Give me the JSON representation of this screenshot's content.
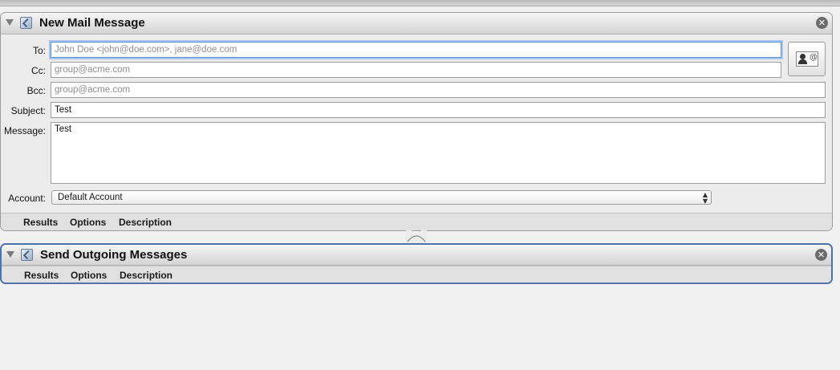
{
  "actions": [
    {
      "title": "New Mail Message",
      "labels": {
        "to": "To:",
        "cc": "Cc:",
        "bcc": "Bcc:",
        "subject": "Subject:",
        "message": "Message:",
        "account": "Account:"
      },
      "fields": {
        "to_placeholder": "John Doe <john@doe.com>, jane@doe.com",
        "cc_placeholder": "group@acme.com",
        "bcc_placeholder": "group@acme.com",
        "subject_value": "Test",
        "message_value": "Test",
        "account_selected": "Default Account"
      },
      "address_button_icon": "address-book-icon",
      "footer_tabs": [
        "Results",
        "Options",
        "Description"
      ]
    },
    {
      "title": "Send Outgoing Messages",
      "footer_tabs": [
        "Results",
        "Options",
        "Description"
      ]
    }
  ],
  "icons": {
    "disclosure": "disclosure-triangle-icon",
    "app": "automator-mail-icon",
    "close": "close-circle-icon",
    "select_arrows": "updown-arrows-icon"
  },
  "colors": {
    "selection_border": "#4f73a8",
    "focus_ring": "#5e8fd0"
  }
}
